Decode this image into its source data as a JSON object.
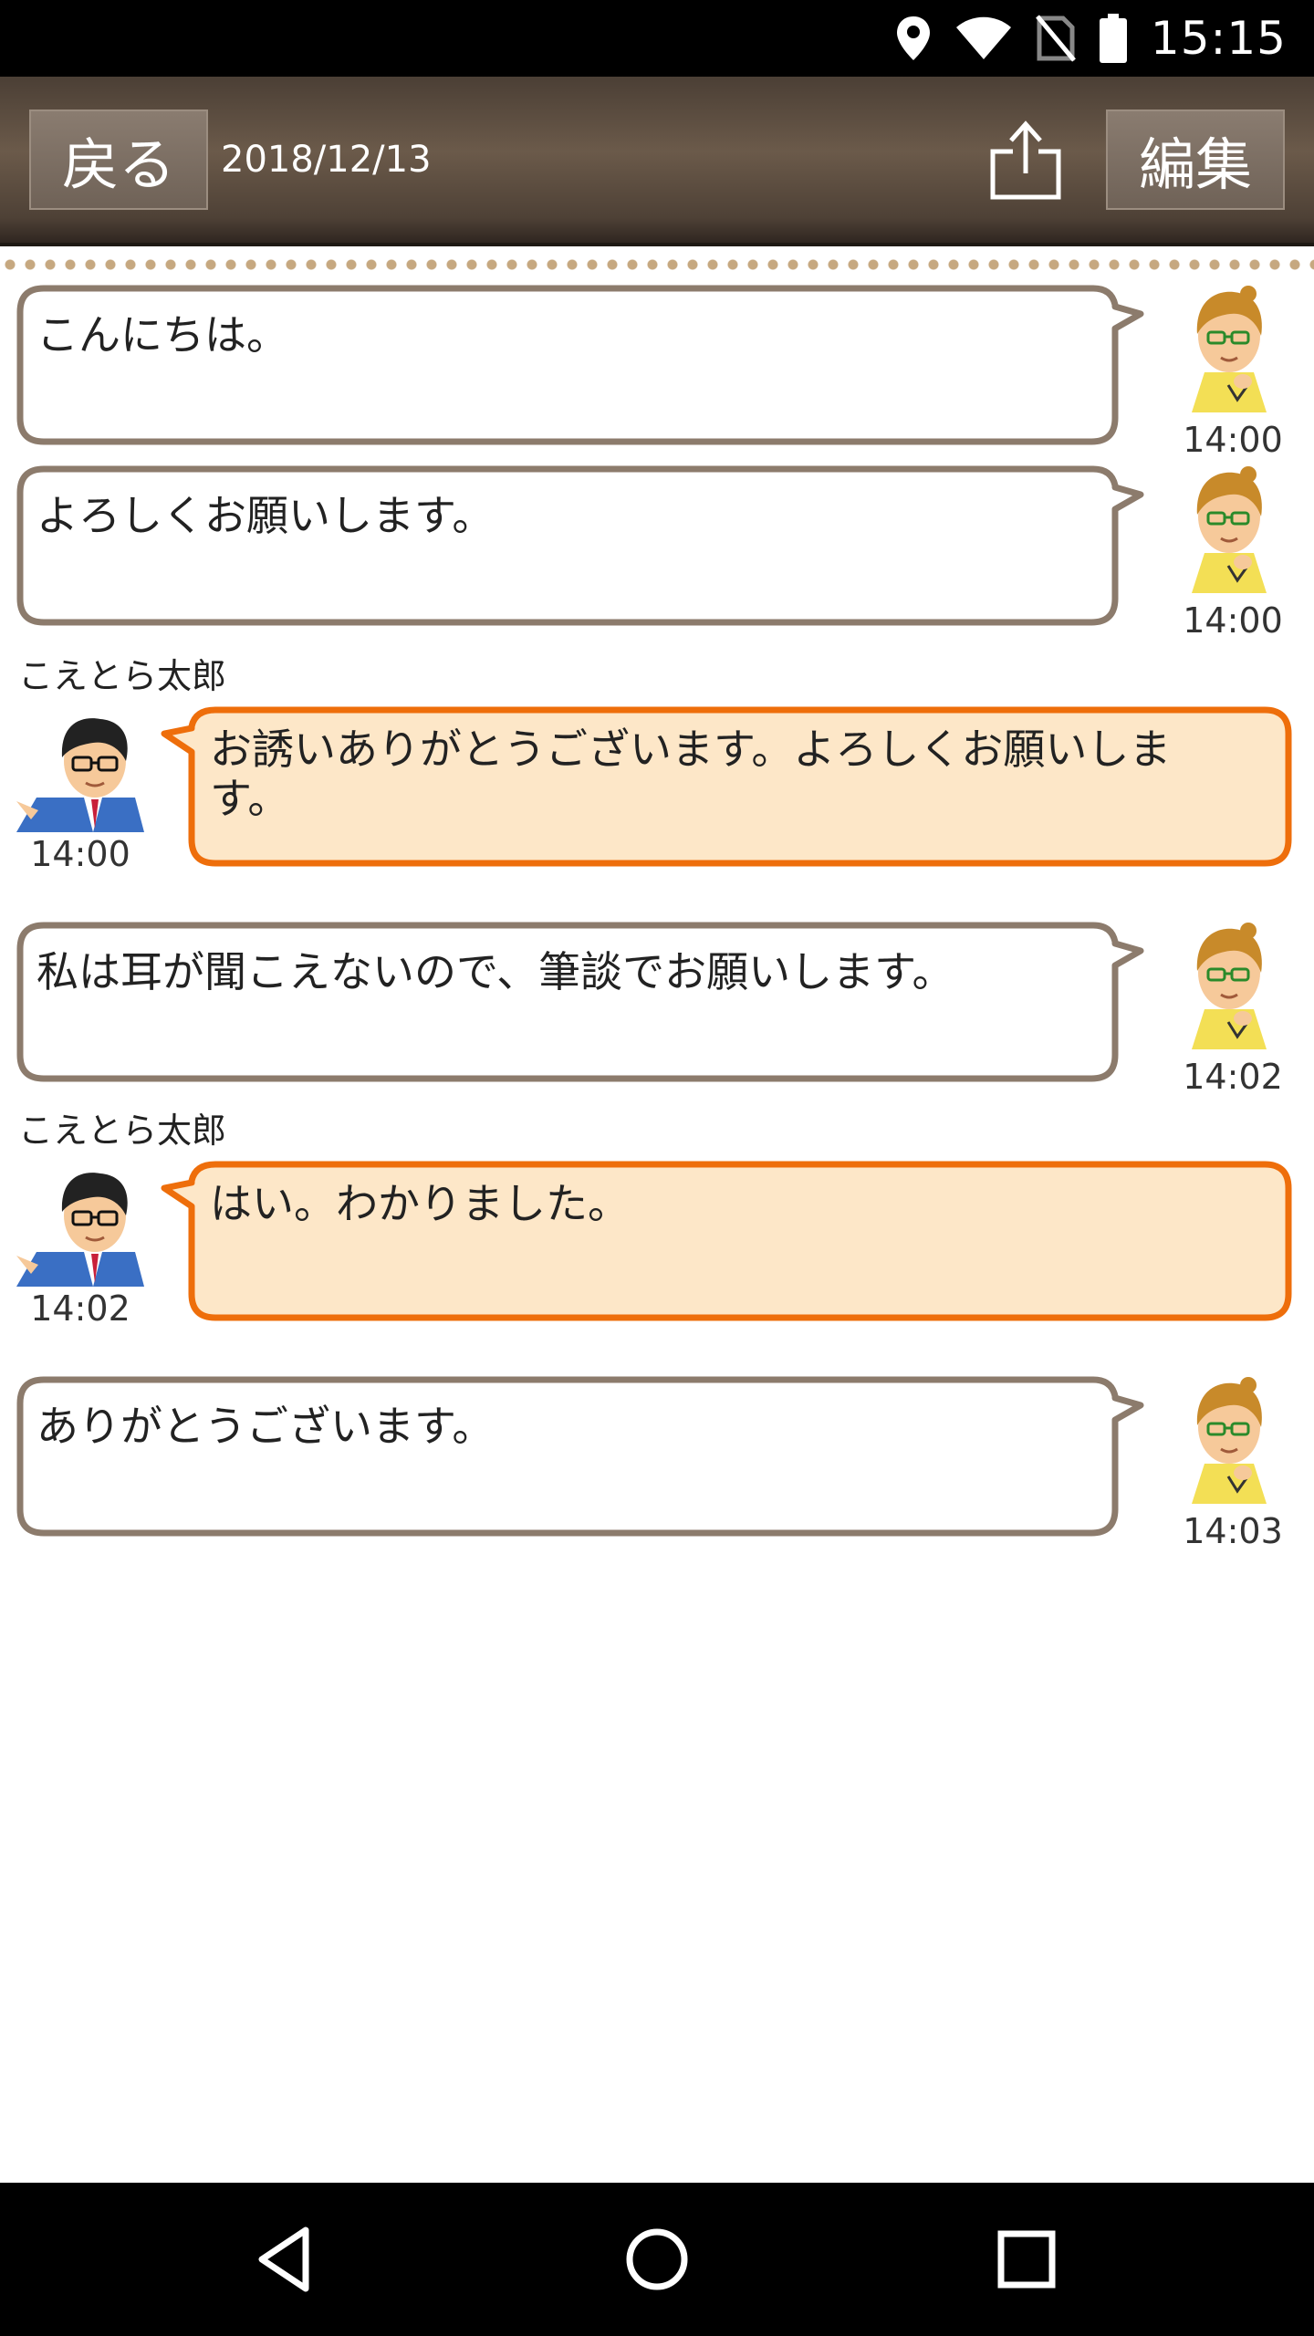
{
  "status_bar": {
    "time": "15:15",
    "icons": [
      "location-icon",
      "wifi-icon",
      "no-sim-icon",
      "battery-icon"
    ]
  },
  "app_bar": {
    "back_label": "戻る",
    "date": "2018/12/13",
    "share_icon": "share-icon",
    "edit_label": "編集"
  },
  "messages": [
    {
      "side": "right",
      "text_lines": [
        "こんにちは。"
      ],
      "time": "14:00",
      "sender": ""
    },
    {
      "side": "right",
      "text_lines": [
        "よろしくお願いします。"
      ],
      "time": "14:00",
      "sender": ""
    },
    {
      "side": "left",
      "text_lines": [
        "お誘いありがとうございます。よろしくお願いしま",
        "す。"
      ],
      "time": "14:00",
      "sender": "こえとら太郎"
    },
    {
      "side": "right",
      "text_lines": [
        "私は耳が聞こえないので、筆談でお願いします。"
      ],
      "time": "14:02",
      "sender": ""
    },
    {
      "side": "left",
      "text_lines": [
        "はい。わかりました。"
      ],
      "time": "14:02",
      "sender": "こえとら太郎"
    },
    {
      "side": "right",
      "text_lines": [
        "ありがとうございます。"
      ],
      "time": "14:03",
      "sender": ""
    }
  ],
  "nav_bar": {
    "icons": [
      "back-triangle-icon",
      "home-circle-icon",
      "recents-square-icon"
    ]
  },
  "colors": {
    "self_bubble_border": "#8c7b6c",
    "other_bubble_border": "#ee6e0b",
    "other_bubble_fill": "#fde7c8"
  }
}
